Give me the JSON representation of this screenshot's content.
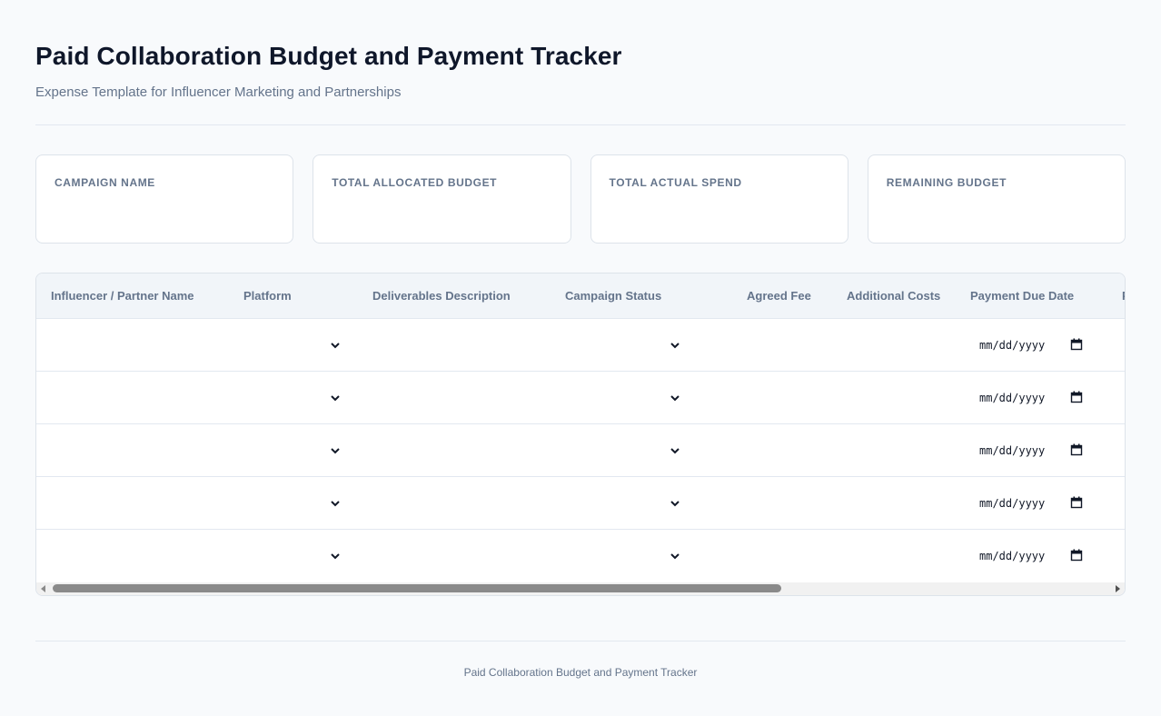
{
  "header": {
    "title": "Paid Collaboration Budget and Payment Tracker",
    "subtitle": "Expense Template for Influencer Marketing and Partnerships"
  },
  "summary": {
    "campaign_name": "CAMPAIGN NAME",
    "total_allocated_budget": "TOTAL ALLOCATED BUDGET",
    "total_actual_spend": "TOTAL ACTUAL SPEND",
    "remaining_budget": "REMAINING BUDGET"
  },
  "table": {
    "columns": [
      "Influencer / Partner Name",
      "Platform",
      "Deliverables Description",
      "Campaign Status",
      "Agreed Fee",
      "Additional Costs",
      "Payment Due Date",
      "P"
    ],
    "date_placeholder": "mm/dd/yyyy",
    "row_count": 5
  },
  "scrollbar": {
    "thumb_fraction": 0.69
  },
  "footer": {
    "text": "Paid Collaboration Budget and Payment Tracker"
  }
}
